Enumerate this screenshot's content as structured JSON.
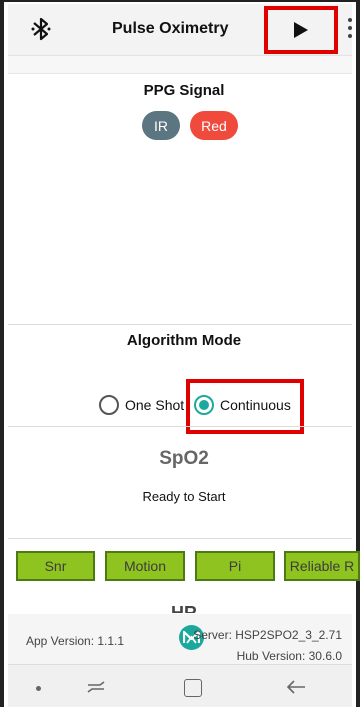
{
  "app_bar": {
    "title": "Pulse Oximetry",
    "icons": {
      "bluetooth": "bluetooth-icon",
      "play": "play-icon",
      "menu": "more-vertical-icon"
    }
  },
  "ppg": {
    "title": "PPG Signal",
    "chips": [
      {
        "label": "IR",
        "color": "#5b7581"
      },
      {
        "label": "Red",
        "color": "#f04a3c"
      }
    ]
  },
  "algorithm": {
    "title": "Algorithm Mode",
    "options": [
      {
        "label": "One Shot",
        "selected": false
      },
      {
        "label": "Continuous",
        "selected": true
      }
    ]
  },
  "spo2": {
    "title": "SpO2",
    "status": "Ready to Start"
  },
  "metrics": {
    "buttons": [
      "Snr",
      "Motion",
      "Pi",
      "Reliable R"
    ]
  },
  "hr": {
    "title": "HR"
  },
  "footer": {
    "app_version": "App Version: 1.1.1",
    "server": "Server: HSP2SPO2_3_2.71",
    "hub_version": "Hub Version: 30.6.0"
  },
  "colors": {
    "accent_teal": "#1aa99c",
    "button_green": "#8fc31f",
    "highlight_red": "#e00000"
  }
}
